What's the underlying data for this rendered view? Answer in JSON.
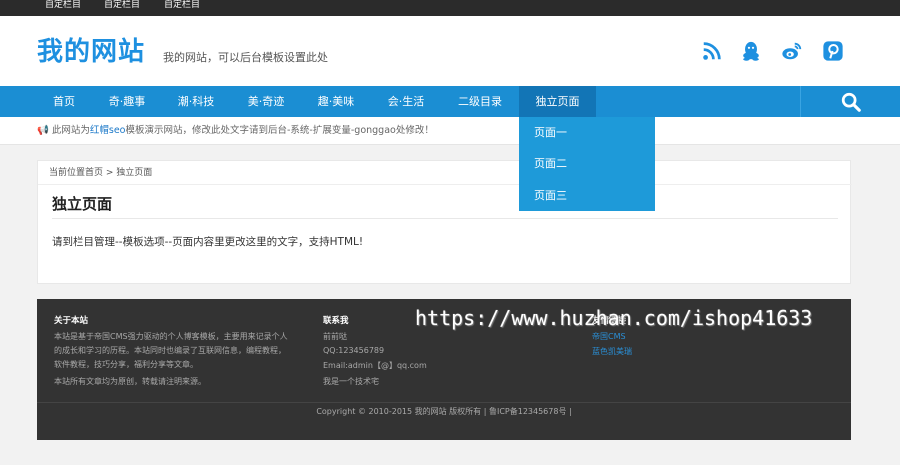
{
  "topbar": {
    "links": [
      "自定栏目",
      "自定栏目",
      "自定栏目"
    ]
  },
  "header": {
    "logo": "我的网站",
    "slogan": "我的网站，可以后台模板设置此处",
    "social_icons": [
      "rss-icon",
      "qq-icon",
      "weibo-icon",
      "pinterest-icon"
    ],
    "brand_color": "#1e90e0"
  },
  "nav": {
    "items": [
      "首页",
      "奇·趣事",
      "潮·科技",
      "美·奇迹",
      "趣·美味",
      "会·生活",
      "二级目录",
      "独立页面"
    ],
    "active_index": 7,
    "color": "#1b8ed3"
  },
  "dropdown": {
    "items": [
      "页面一",
      "页面二",
      "页面三"
    ]
  },
  "notice": {
    "prefix": "此网站为",
    "highlight": "红帽seo",
    "suffix": "模板演示网站，修改此处文字请到后台-系统-扩展变量-gonggao处修改！"
  },
  "content": {
    "breadcrumb": "当前位置首页 > 独立页面",
    "title": "独立页面",
    "body": "请到栏目管理--模板选项--页面内容里更改这里的文字，支持HTML!"
  },
  "footer": {
    "about": {
      "title": "关于本站",
      "lines": [
        "本站是基于帝国CMS强力驱动的个人博客模板，主要用来记录个人",
        "的成长和学习的历程。本站同时也编录了互联网信息，编程教程，",
        "软件教程，技巧分享，福利分享等文章。",
        "本站所有文章均为原创，转载请注明来源。"
      ]
    },
    "contact": {
      "title": "联系我",
      "lines": [
        "前前哒",
        "QQ:123456789",
        "Email:admin【@】qq.com",
        "我是一个技术宅"
      ]
    },
    "friends": {
      "title": "友情链接",
      "links": [
        "帝国CMS",
        "蓝色凯美瑞"
      ]
    },
    "copyright": "Copyright © 2010-2015 我的网站 版权所有 | 鲁ICP备12345678号 |"
  },
  "watermark": "https://www.huzhan.com/ishop41633"
}
